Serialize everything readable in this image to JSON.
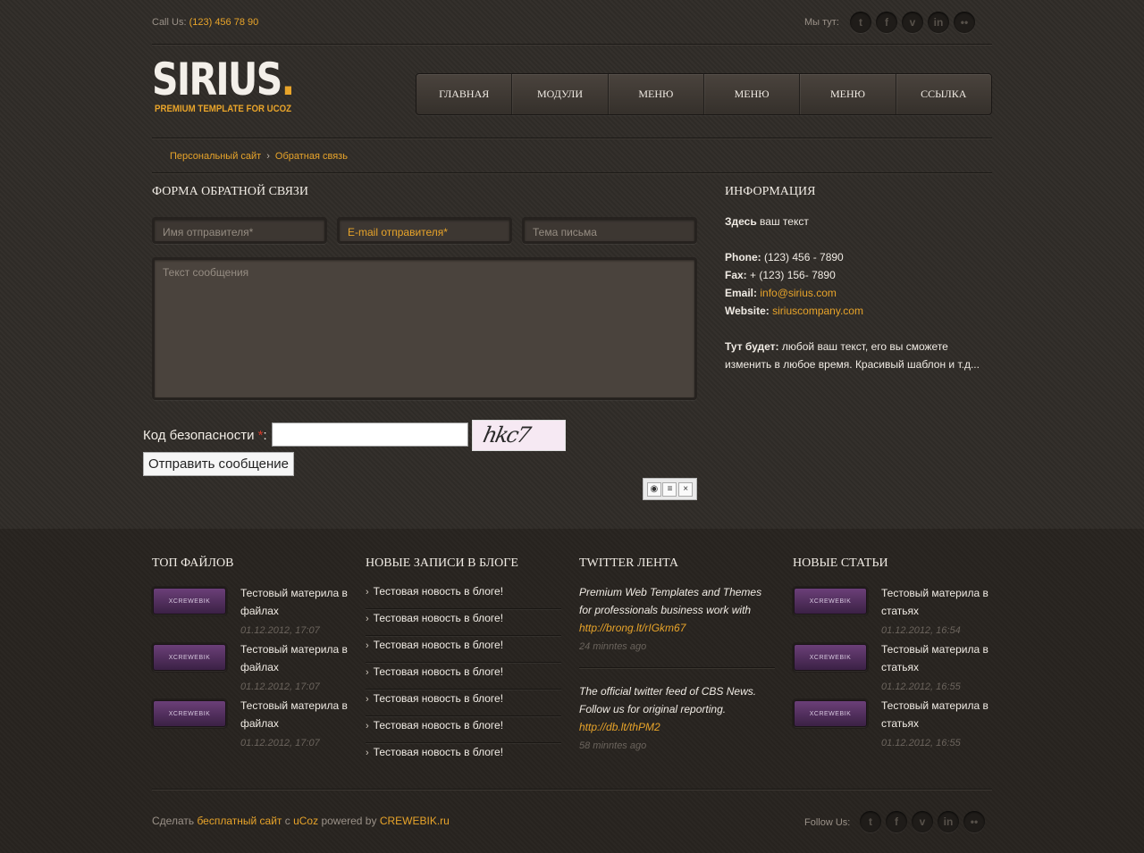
{
  "top_bar": {
    "call_label": "Call Us:",
    "phone": "(123) 456 78 90",
    "social_label": "Мы тут:",
    "social_icons": [
      "twitter-icon",
      "facebook-icon",
      "vimeo-icon",
      "linkedin-icon",
      "flickr-icon"
    ]
  },
  "logo": {
    "main": "SIRIUS",
    "dot": ".",
    "tagline": "PREMIUM TEMPLATE FOR UCOZ"
  },
  "nav": {
    "items": [
      "ГЛАВНАЯ",
      "МОДУЛИ",
      "МЕНЮ",
      "МЕНЮ",
      "МЕНЮ",
      "ССЫЛКА"
    ]
  },
  "breadcrumb": {
    "home": "Персональный сайт",
    "separator": "›",
    "current": "Обратная связь"
  },
  "form": {
    "title": "ФОРМА ОБРАТНОЙ СВЯЗИ",
    "name_placeholder": "Имя отправителя*",
    "email_placeholder": "E-mail отправителя*",
    "subject_placeholder": "Тема письма",
    "message_placeholder": "Текст сообщения",
    "captcha_label": "Код безопасности",
    "captcha_required": "*",
    "captcha_colon": ":",
    "captcha_image_text": "hkc7",
    "submit_label": "Отправить сообщение"
  },
  "info": {
    "title": "ИНФОРМАЦИЯ",
    "intro_bold": "Здесь",
    "intro_text": " ваш текст",
    "phone_label": "Phone:",
    "phone": " (123) 456 - 7890",
    "fax_label": "Fax:",
    "fax": " + (123) 156- 7890",
    "email_label": "Email:",
    "email": "info@sirius.com",
    "website_label": "Website:",
    "website": "siriuscompany.com",
    "note_label": "Тут будет:",
    "note_text": " любой ваш текст, его вы сможете изменить в любое время. Красивый шаблон и т.д..."
  },
  "footer": {
    "top_files": {
      "title": "ТОП ФАЙЛОВ",
      "items": [
        {
          "thumb": "XCREWEBIK",
          "title": "Тестовый материла в файлах",
          "date": "01.12.2012, 17:07"
        },
        {
          "thumb": "XCREWEBIK",
          "title": "Тестовый материла в файлах",
          "date": "01.12.2012, 17:07"
        },
        {
          "thumb": "XCREWEBIK",
          "title": "Тестовый материла в файлах",
          "date": "01.12.2012, 17:07"
        }
      ]
    },
    "blog": {
      "title": "НОВЫЕ ЗАПИСИ В БЛОГЕ",
      "items": [
        "Тестовая новость в блоге!",
        "Тестовая новость в блоге!",
        "Тестовая новость в блоге!",
        "Тестовая новость в блоге!",
        "Тестовая новость в блоге!",
        "Тестовая новость в блоге!",
        "Тестовая новость в блоге!"
      ]
    },
    "twitter": {
      "title": "TWITTER ЛЕНТА",
      "tweets": [
        {
          "text": "Premium Web Templates and Themes for professionals business work with ",
          "link": "http://brong.lt/rIGkm67",
          "time": "24 minntes ago"
        },
        {
          "text": "The official twitter feed of CBS News. Follow us for original reporting. ",
          "link": "http://db.lt/thPM2",
          "time": "58 minntes ago"
        }
      ]
    },
    "articles": {
      "title": "НОВЫЕ СТАТЬИ",
      "items": [
        {
          "thumb": "XCREWEBIK",
          "title": "Тестовый материла в статьях",
          "date": "01.12.2012, 16:54"
        },
        {
          "thumb": "XCREWEBIK",
          "title": "Тестовый материла в статьях",
          "date": "01.12.2012, 16:55"
        },
        {
          "thumb": "XCREWEBIK",
          "title": "Тестовый материла в статьях",
          "date": "01.12.2012, 16:55"
        }
      ]
    },
    "copyright": {
      "prefix": "Сделать ",
      "link1": "бесплатный сайт",
      "mid": " с ",
      "link2": "uCoz",
      "mid2": " powered by ",
      "link3": "CREWEBIK.ru"
    },
    "follow_label": "Follow Us:"
  }
}
